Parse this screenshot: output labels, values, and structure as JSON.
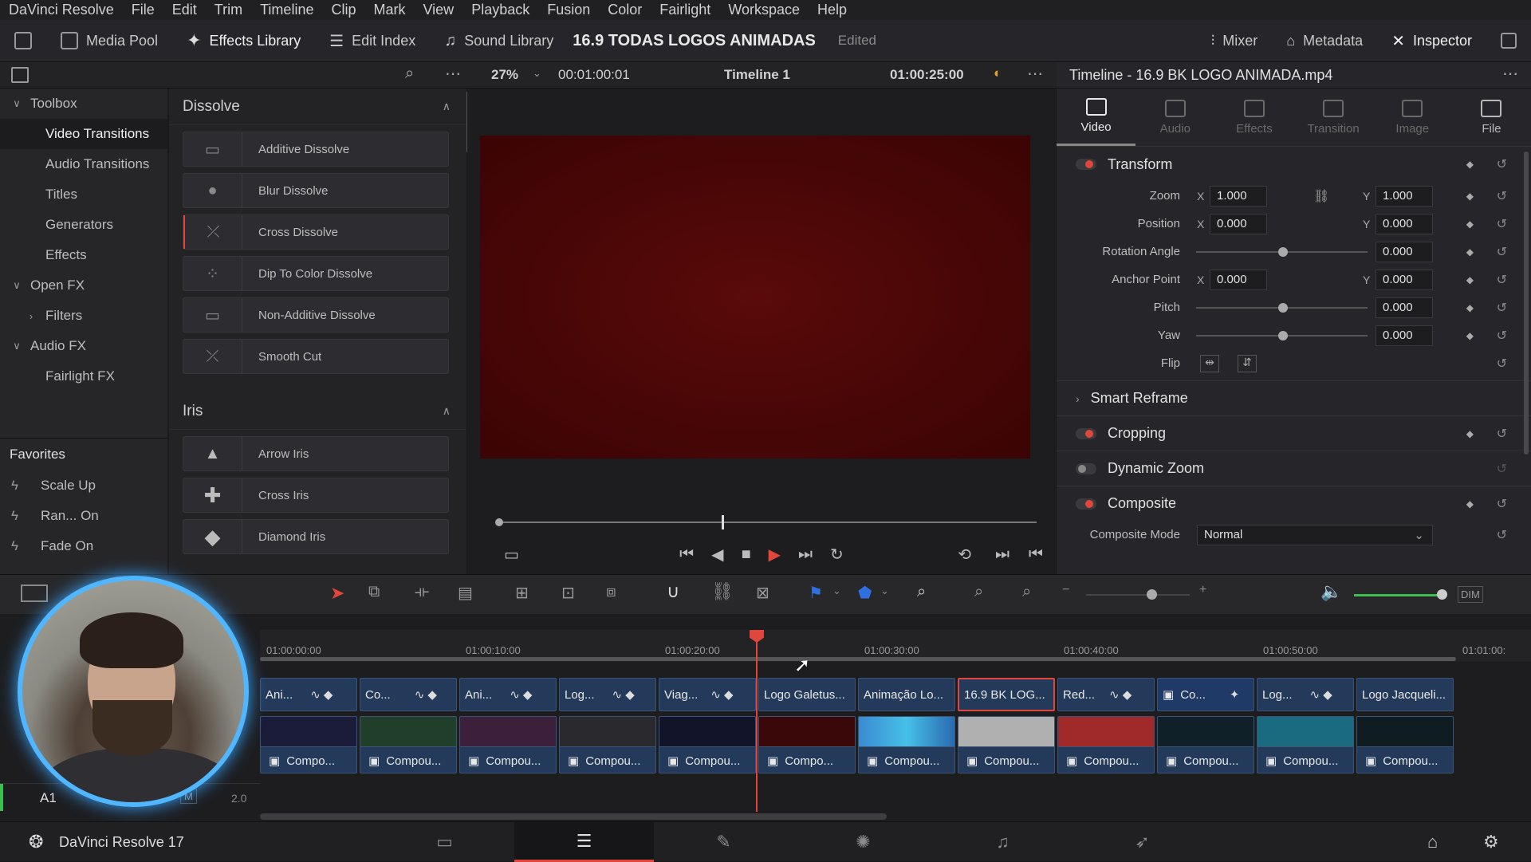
{
  "menubar": {
    "items": [
      "DaVinci Resolve",
      "File",
      "Edit",
      "Trim",
      "Timeline",
      "Clip",
      "Mark",
      "View",
      "Playback",
      "Fusion",
      "Color",
      "Fairlight",
      "Workspace",
      "Help"
    ]
  },
  "toolbar": {
    "media_pool": "Media Pool",
    "effects_library": "Effects Library",
    "edit_index": "Edit Index",
    "sound_library": "Sound Library",
    "project_title": "16.9 TODAS LOGOS ANIMADAS",
    "project_status": "Edited",
    "mixer": "Mixer",
    "metadata": "Metadata",
    "inspector": "Inspector"
  },
  "toolbox": {
    "items": [
      {
        "label": "Toolbox",
        "level": 0,
        "chevron": "v"
      },
      {
        "label": "Video Transitions",
        "level": 1,
        "selected": true
      },
      {
        "label": "Audio Transitions",
        "level": 1
      },
      {
        "label": "Titles",
        "level": 1
      },
      {
        "label": "Generators",
        "level": 1
      },
      {
        "label": "Effects",
        "level": 1
      },
      {
        "label": "Open FX",
        "level": 0,
        "chevron": "v"
      },
      {
        "label": "Filters",
        "level": 1,
        "chevron": ">"
      },
      {
        "label": "Audio FX",
        "level": 0,
        "chevron": "v"
      },
      {
        "label": "Fairlight FX",
        "level": 1
      }
    ]
  },
  "favorites": {
    "title": "Favorites",
    "items": [
      "Scale Up",
      "Ran... On",
      "Fade On"
    ]
  },
  "effects": {
    "dissolve_title": "Dissolve",
    "dissolve": [
      "Additive Dissolve",
      "Blur Dissolve",
      "Cross Dissolve",
      "Dip To Color Dissolve",
      "Non-Additive Dissolve",
      "Smooth Cut"
    ],
    "iris_title": "Iris",
    "iris": [
      "Arrow Iris",
      "Cross Iris",
      "Diamond Iris"
    ]
  },
  "viewer": {
    "zoom": "27%",
    "duration": "00:01:00:01",
    "timeline_name": "Timeline 1",
    "timecode": "01:00:25:00"
  },
  "inspector": {
    "title": "Timeline - 16.9 BK LOGO ANIMADA.mp4",
    "tabs": [
      {
        "label": "Video",
        "active": true
      },
      {
        "label": "Audio"
      },
      {
        "label": "Effects"
      },
      {
        "label": "Transition"
      },
      {
        "label": "Image"
      },
      {
        "label": "File",
        "active_ish": true
      }
    ],
    "transform": "Transform",
    "zoom_label": "Zoom",
    "zoom_x": "1.000",
    "zoom_y": "1.000",
    "position_label": "Position",
    "position_x": "0.000",
    "position_y": "0.000",
    "rotation_label": "Rotation Angle",
    "rotation": "0.000",
    "anchor_label": "Anchor Point",
    "anchor_x": "0.000",
    "anchor_y": "0.000",
    "pitch_label": "Pitch",
    "pitch": "0.000",
    "yaw_label": "Yaw",
    "yaw": "0.000",
    "flip_label": "Flip",
    "smart_reframe": "Smart Reframe",
    "cropping": "Cropping",
    "dynamic_zoom": "Dynamic Zoom",
    "composite": "Composite",
    "composite_mode_label": "Composite Mode",
    "composite_mode": "Normal",
    "axis_x": "X",
    "axis_y": "Y"
  },
  "timeline": {
    "ruler": [
      "01:00:00:00",
      "01:00:10:00",
      "01:00:20:00",
      "01:00:30:00",
      "01:00:40:00",
      "01:00:50:00",
      "01:01:00:"
    ],
    "clips_top": [
      "Ani...",
      "Co...",
      "Ani...",
      "Log...",
      "Viag...",
      "Logo Galetus...",
      "Animação Lo...",
      "16.9 BK LOG...",
      "Red...",
      "Co...",
      "Log...",
      "Logo Jacqueli..."
    ],
    "compound_label_short": "Compo...",
    "compound_label": "Compou...",
    "audio_track": "A1",
    "audio_m": "M",
    "audio_level": "2.0",
    "dim": "DIM"
  },
  "colors": {
    "accent": "#e0463c",
    "clip": "#243a5a",
    "playhead": "#e0463c",
    "webcam_ring": "#4fb6ff"
  },
  "statusbar": {
    "app": "DaVinci Resolve 17"
  }
}
